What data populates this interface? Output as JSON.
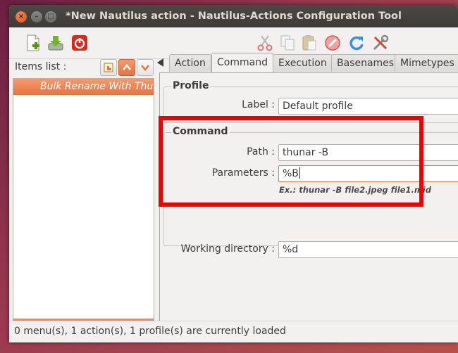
{
  "window": {
    "title": "*New Nautilus action - Nautilus-Actions Configuration Tool",
    "close_glyph": "×",
    "minimize_glyph": "–",
    "maximize_glyph": "□"
  },
  "toolbar": {
    "left_icons": [
      "new-action-icon",
      "save-icon",
      "quit-icon"
    ],
    "right_icons": [
      "cut-icon",
      "copy-icon",
      "paste-icon",
      "delete-icon",
      "reload-icon",
      "preferences-icon"
    ]
  },
  "items_panel": {
    "label": "Items list :",
    "items": [
      {
        "label": "Bulk Rename With Thunar",
        "selected": true
      }
    ]
  },
  "tabs": [
    {
      "label": "Action",
      "active": false
    },
    {
      "label": "Command",
      "active": true
    },
    {
      "label": "Execution",
      "active": false
    },
    {
      "label": "Basenames",
      "active": false
    },
    {
      "label": "Mimetypes",
      "active": false
    }
  ],
  "profile": {
    "section_title": "Profile",
    "label_caption": "Label :",
    "label_value": "Default profile"
  },
  "command": {
    "section_title": "Command",
    "path_caption": "Path :",
    "path_value": "thunar -B",
    "parameters_caption": "Parameters :",
    "parameters_value": "%B",
    "example": "Ex.: thunar -B file2.jpeg file1.mid",
    "working_dir_caption": "Working directory :",
    "working_dir_value": "%d"
  },
  "status_bar": {
    "text": "0 menu(s), 1 action(s), 1 profile(s) are currently loaded"
  },
  "colors": {
    "accent": "#e8733f",
    "highlight_box": "#f20000",
    "titlebar": "#3c3b37"
  }
}
